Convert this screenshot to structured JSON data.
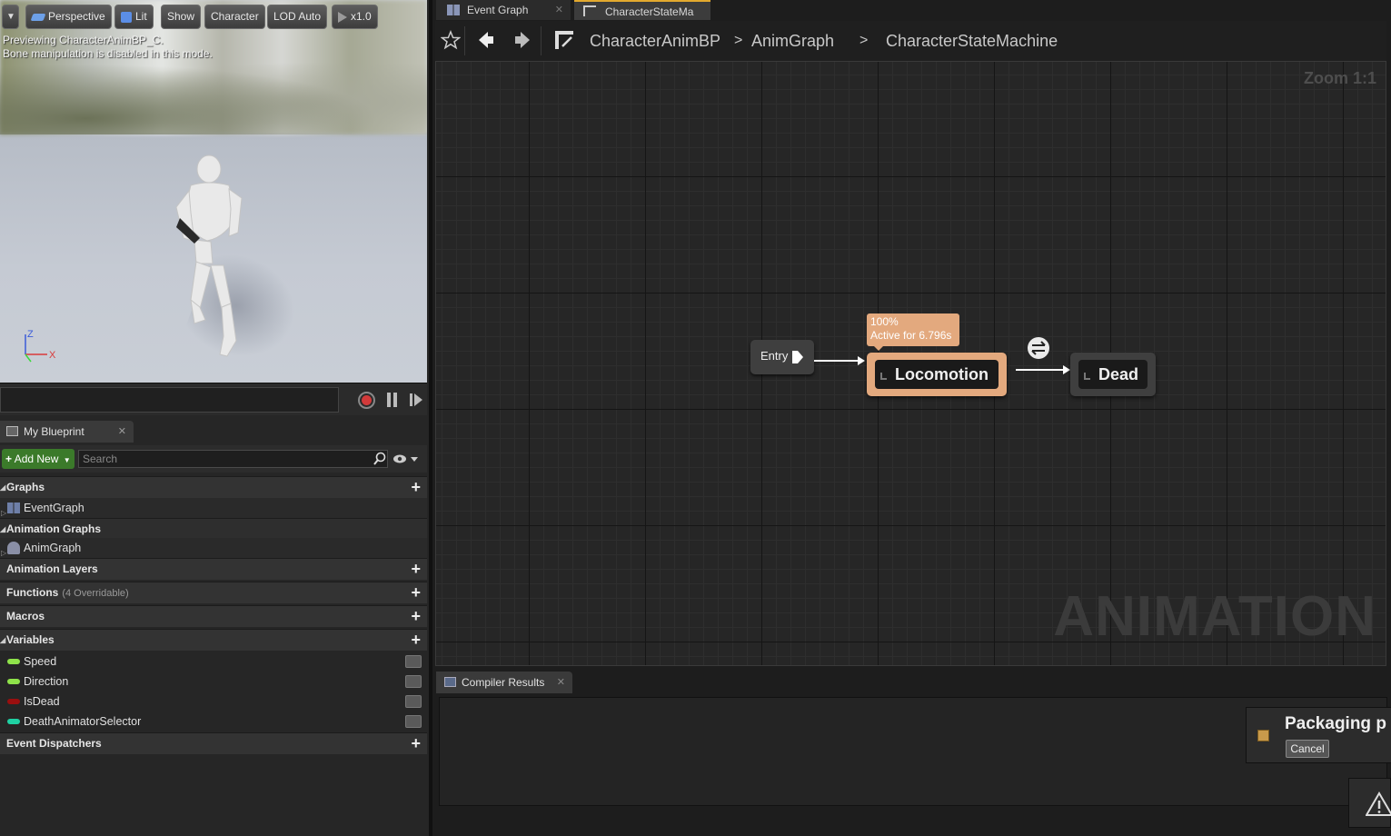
{
  "viewport": {
    "toolbar": {
      "perspective": "Perspective",
      "lit": "Lit",
      "show": "Show",
      "character": "Character",
      "lod": "LOD Auto",
      "speed": "x1.0"
    },
    "message_line1": "Previewing CharacterAnimBP_C.",
    "message_line2": "Bone manipulation is disabled in this mode.",
    "axis_z": "Z",
    "axis_x": "X"
  },
  "my_blueprint": {
    "tab_label": "My Blueprint",
    "add_new": "Add New",
    "search_placeholder": "Search",
    "sections": {
      "graphs": "Graphs",
      "animation_graphs": "Animation Graphs",
      "animation_layers": "Animation Layers",
      "functions": "Functions",
      "functions_sub": "(4 Overridable)",
      "macros": "Macros",
      "variables": "Variables",
      "event_dispatchers": "Event Dispatchers"
    },
    "graph_items": [
      "EventGraph"
    ],
    "anim_graph_items": [
      "AnimGraph"
    ],
    "variables": [
      {
        "name": "Speed",
        "color": "#8fe34a"
      },
      {
        "name": "Direction",
        "color": "#8fe34a"
      },
      {
        "name": "IsDead",
        "color": "#9a0f0f"
      },
      {
        "name": "DeathAnimatorSelector",
        "color": "#1fd1a3"
      }
    ]
  },
  "tabs": {
    "event_graph": "Event Graph",
    "state_machine": "CharacterStateMa"
  },
  "breadcrumb": {
    "root": "CharacterAnimBP",
    "level2": "AnimGraph",
    "level3": "CharacterStateMachine"
  },
  "graph": {
    "zoom": "Zoom 1:1",
    "watermark": "ANIMATION",
    "entry_label": "Entry",
    "tooltip_line1": "100%",
    "tooltip_line2": "Active for 6.796s",
    "state_locomotion": "Locomotion",
    "state_dead": "Dead",
    "accent_active": "#e3a97e"
  },
  "compiler": {
    "tab_label": "Compiler Results",
    "packaging_title": "Packaging p",
    "cancel": "Cancel"
  }
}
